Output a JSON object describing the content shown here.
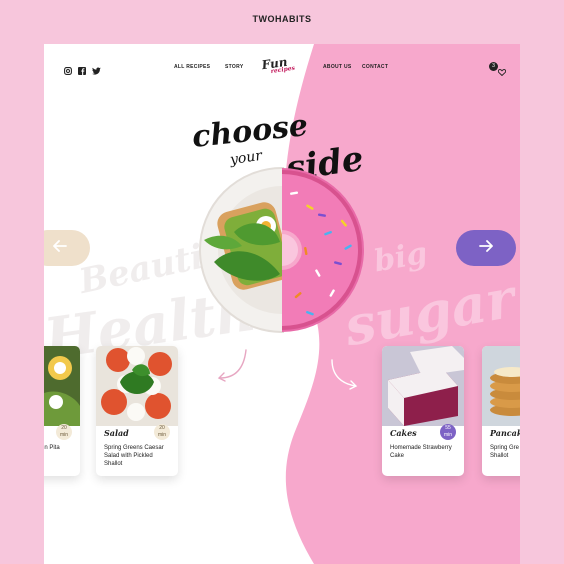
{
  "brand": "TWOHABITS",
  "nav": {
    "links": [
      "ALL RECIPES",
      "STORY",
      "ABOUT US",
      "CONTACT"
    ],
    "logo_main": "Fun",
    "logo_sub": "recipes",
    "cart_count": "3"
  },
  "hero": {
    "word1": "choose",
    "word2": "your",
    "word3": "side"
  },
  "background_words": {
    "left_top": "Beautiful",
    "left_bottom": "Health",
    "right_top": "big",
    "right_bottom": "sugar"
  },
  "cards": [
    {
      "category": "",
      "time": "20",
      "time_unit": "min",
      "desc": "ken Pita"
    },
    {
      "category": "Salad",
      "time": "20",
      "time_unit": "min",
      "desc": "Spring Greens Caesar Salad with Pickled Shallot"
    },
    {
      "category": "Cakes",
      "time": "55",
      "time_unit": "min",
      "desc": "Homemade Strawberry Cake"
    },
    {
      "category": "Pancak",
      "time": "",
      "time_unit": "",
      "desc": "Spring Gre Salad with Shallot"
    }
  ],
  "colors": {
    "page_bg": "#f7c6dc",
    "pink_side": "#f7a8cc",
    "left_arrow": "#efe0cb",
    "right_arrow": "#7d62c5",
    "time_badge_light": "#f3ead8",
    "time_badge_purple": "#7d62c5"
  }
}
